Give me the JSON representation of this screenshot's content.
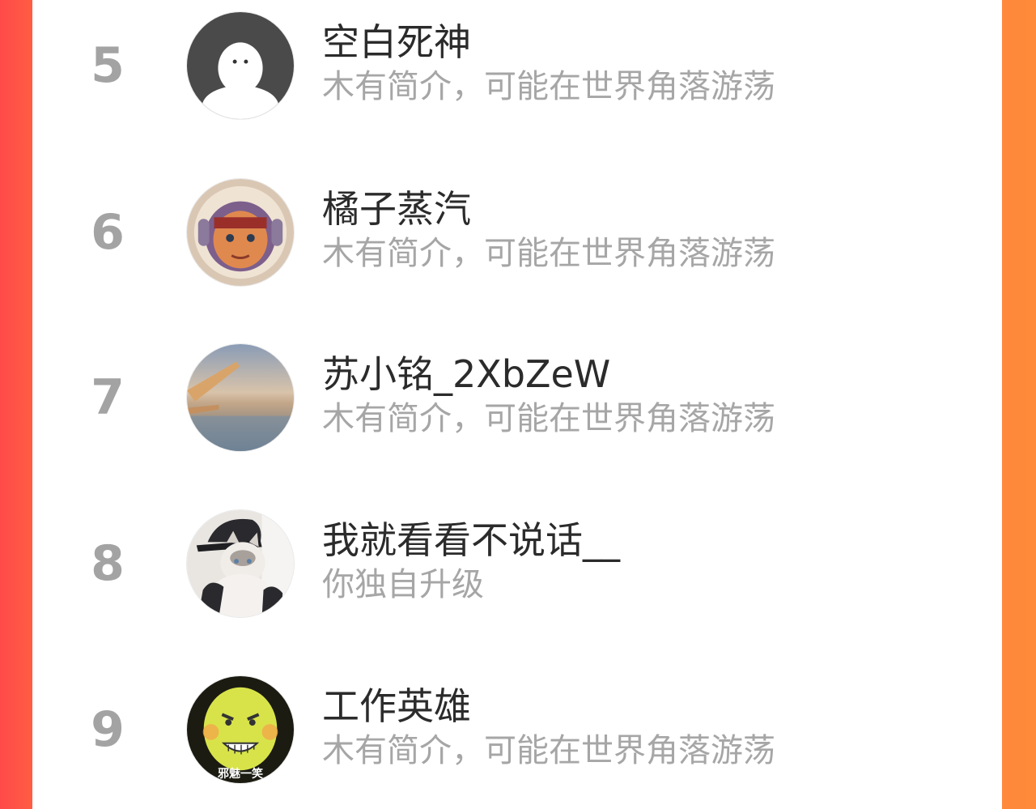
{
  "colors": {
    "rank": "#a3a3a3",
    "name": "#2b2b2b",
    "bio": "#a6a6a6",
    "background_left": "#ff4a4a",
    "background_right": "#ff8a3a"
  },
  "list": [
    {
      "rank": "5",
      "name": "空白死神",
      "bio": "木有简介，可能在世界角落游荡",
      "avatar": "default-ghost-avatar"
    },
    {
      "rank": "6",
      "name": "橘子蒸汽",
      "bio": "木有简介，可能在世界角落游荡",
      "avatar": "astronaut-avatar"
    },
    {
      "rank": "7",
      "name": "苏小铭_2XbZeW",
      "bio": "木有简介，可能在世界角落游荡",
      "avatar": "airplane-sky-avatar"
    },
    {
      "rank": "8",
      "name": "我就看看不说话__",
      "bio": "你独自升级",
      "avatar": "cat-photo-avatar"
    },
    {
      "rank": "9",
      "name": "工作英雄",
      "bio": "木有简介，可能在世界角落游荡",
      "avatar": "meme-face-avatar",
      "avatar_caption": "邪魅一笑"
    }
  ]
}
